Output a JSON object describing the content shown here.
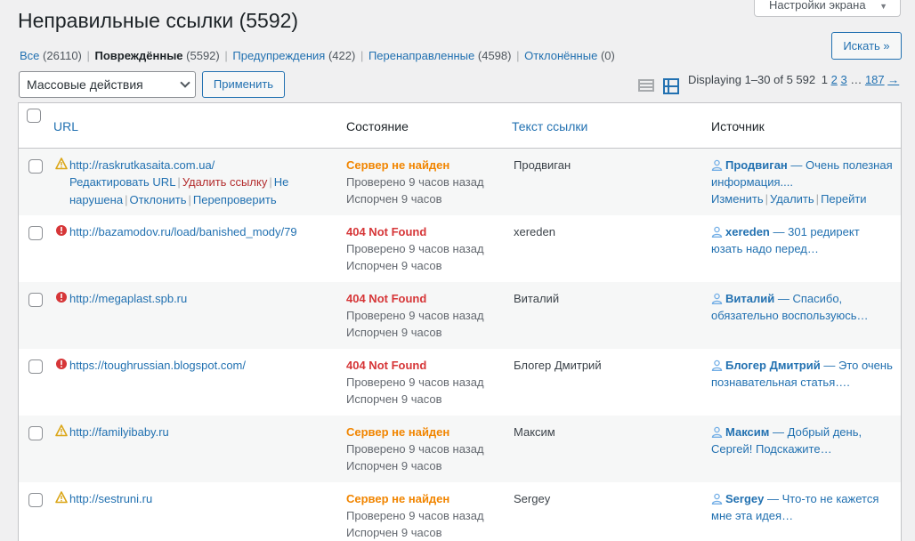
{
  "title": "Неправильные ссылки (5592)",
  "screen_options": "Настройки экрана",
  "search_button": "Искать »",
  "filters": [
    {
      "label": "Все",
      "count": "(26110)"
    },
    {
      "label": "Повреждённые",
      "count": "(5592)"
    },
    {
      "label": "Предупреждения",
      "count": "(422)"
    },
    {
      "label": "Перенаправленные",
      "count": "(4598)"
    },
    {
      "label": "Отклонённые",
      "count": "(0)"
    }
  ],
  "bulk_actions": "Массовые действия",
  "apply": "Применить",
  "pagination": {
    "displaying": "Displaying 1–30 of 5 592",
    "current": "1",
    "p2": "2",
    "p3": "3",
    "ellipsis": "…",
    "last": "187",
    "next": "→"
  },
  "columns": {
    "url": "URL",
    "state": "Состояние",
    "text": "Текст ссылки",
    "source": "Источник"
  },
  "row_actions": {
    "edit": "Редактировать URL",
    "delete": "Удалить ссылку",
    "not_broken": "Не нарушена",
    "dismiss": "Отклонить",
    "recheck": "Перепроверить"
  },
  "source_actions": {
    "edit": "Изменить",
    "delete": "Удалить",
    "go": "Перейти"
  },
  "rows": [
    {
      "url": "http://raskrutkasaita.com.ua/",
      "status": "Сервер не найден",
      "checked": "Проверено 9 часов назад",
      "broken": "Испорчен 9 часов",
      "text": "Продвиган",
      "author": "Продвиган",
      "excerpt": "— Очень полезная информация...."
    },
    {
      "url": "http://bazamodov.ru/load/banished_mody/79",
      "status": "404 Not Found",
      "checked": "Проверено 9 часов назад",
      "broken": "Испорчен 9 часов",
      "text": "xereden",
      "author": "xereden",
      "excerpt": "— 301 редирект юзать надо перед…"
    },
    {
      "url": "http://megaplast.spb.ru",
      "status": "404 Not Found",
      "checked": "Проверено 9 часов назад",
      "broken": "Испорчен 9 часов",
      "text": "Виталий",
      "author": "Виталий",
      "excerpt": "— Спасибо, обязательно воспользуюсь…"
    },
    {
      "url": "https://toughrussian.blogspot.com/",
      "status": "404 Not Found",
      "checked": "Проверено 9 часов назад",
      "broken": "Испорчен 9 часов",
      "text": "Блогер Дмитрий",
      "author": "Блогер Дмитрий",
      "excerpt": "— Это очень познавательная статья…."
    },
    {
      "url": "http://familyibaby.ru",
      "status": "Сервер не найден",
      "checked": "Проверено 9 часов назад",
      "broken": "Испорчен 9 часов",
      "text": "Максим",
      "author": "Максим",
      "excerpt": "— Добрый день, Сергей! Подскажите…"
    },
    {
      "url": "http://sestruni.ru",
      "status": "Сервер не найден",
      "checked": "Проверено 9 часов назад",
      "broken": "Испорчен 9 часов",
      "text": "Sergey",
      "author": "Sergey",
      "excerpt": "— Что-то не кажется мне эта идея…"
    }
  ],
  "colors": {
    "link": "#2271b1",
    "warning": "#f18500",
    "error": "#d63638",
    "delete": "#b32d2e",
    "warning_icon": "#dba617"
  }
}
